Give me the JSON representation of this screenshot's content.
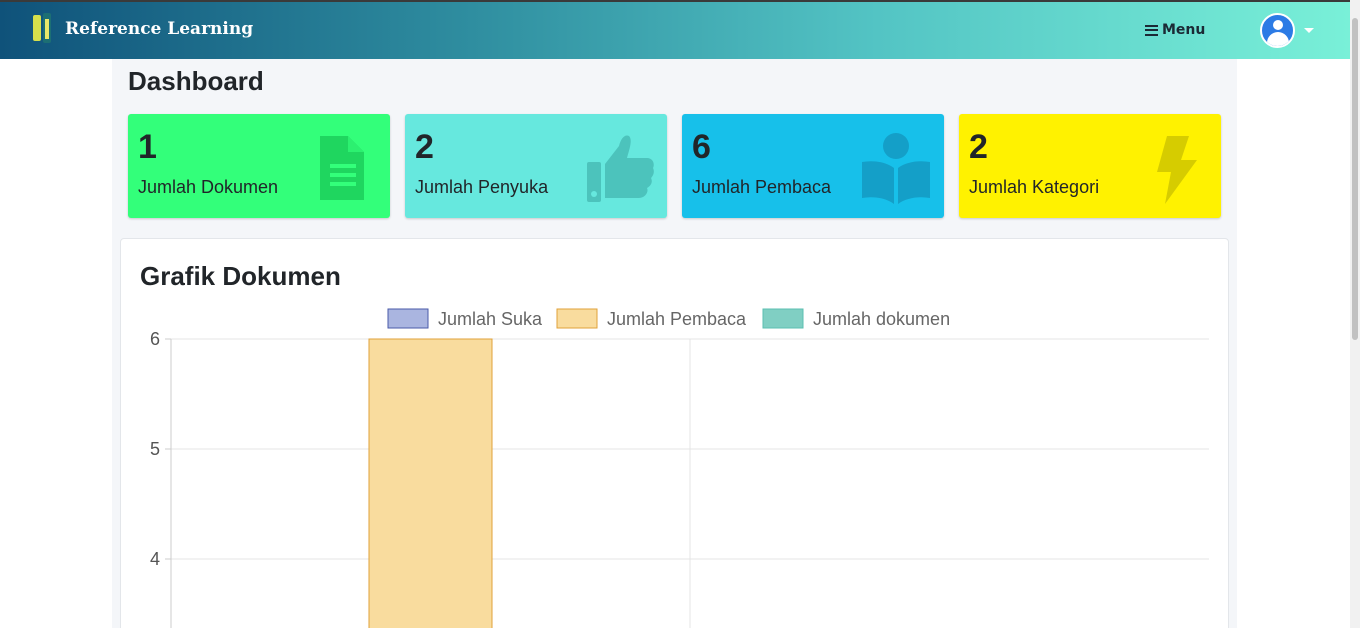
{
  "navbar": {
    "brand": "Reference Learning",
    "menu_label": "Menu",
    "colors": {
      "gradient_start": "#0f527a",
      "gradient_end": "#79f0d8"
    }
  },
  "page": {
    "title": "Dashboard"
  },
  "cards": [
    {
      "value": "1",
      "label": "Jumlah Dokumen",
      "icon": "document-icon",
      "color": "#33ff7a"
    },
    {
      "value": "2",
      "label": "Jumlah Penyuka",
      "icon": "thumbs-up-icon",
      "color": "#66e8de"
    },
    {
      "value": "6",
      "label": "Jumlah Pembaca",
      "icon": "reader-icon",
      "color": "#17c0ea"
    },
    {
      "value": "2",
      "label": "Jumlah Kategori",
      "icon": "bolt-icon",
      "color": "#fff200"
    }
  ],
  "chart": {
    "title": "Grafik Dokumen"
  },
  "chart_data": {
    "type": "bar",
    "title": "Grafik Dokumen",
    "legend_position": "top-center",
    "grid": true,
    "series": [
      {
        "name": "Jumlah Suka",
        "color": "#aab5e0",
        "border": "#4a5aa8",
        "values": [
          null
        ]
      },
      {
        "name": "Jumlah Pembaca",
        "color": "#f9dc9e",
        "border": "#e0a23a",
        "values": [
          6
        ]
      },
      {
        "name": "Jumlah dokumen",
        "color": "#80cfc3",
        "border": "#5bbfb0",
        "values": [
          null
        ]
      }
    ],
    "y_ticks": [
      6,
      5,
      4
    ],
    "ylim_visible": [
      3.4,
      6
    ]
  }
}
